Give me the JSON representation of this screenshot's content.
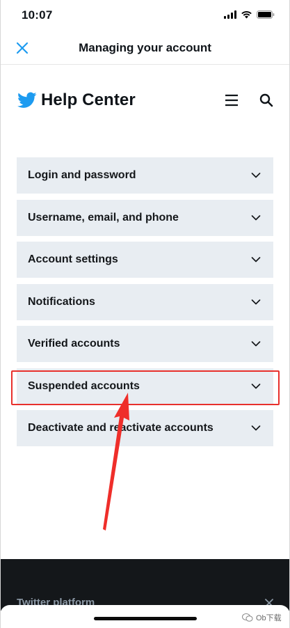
{
  "status_bar": {
    "time": "10:07"
  },
  "nav": {
    "title": "Managing your account"
  },
  "help_center": {
    "title": "Help Center"
  },
  "accordion": {
    "items": [
      {
        "label": "Login and password"
      },
      {
        "label": "Username, email, and phone"
      },
      {
        "label": "Account settings"
      },
      {
        "label": "Notifications"
      },
      {
        "label": "Verified accounts"
      },
      {
        "label": "Suspended accounts",
        "highlighted": true
      },
      {
        "label": "Deactivate and reactivate accounts"
      }
    ]
  },
  "footer": {
    "label": "Twitter platform"
  },
  "watermark": {
    "text": "Ob下载"
  },
  "colors": {
    "accent": "#1d9bf0",
    "item_background": "#e8edf2",
    "highlight": "#e8302c",
    "footer_background": "#14171a"
  }
}
